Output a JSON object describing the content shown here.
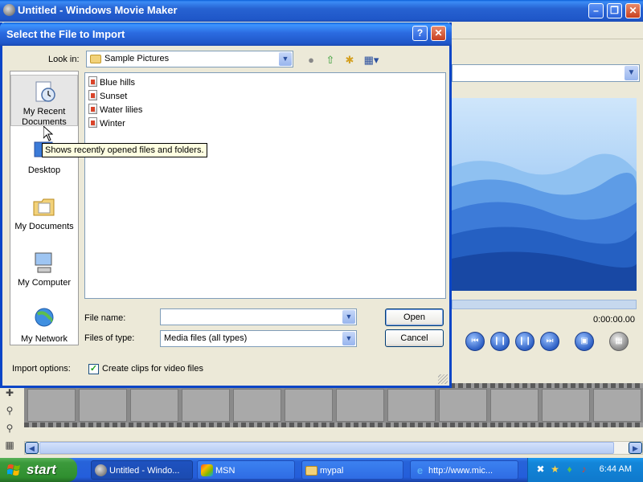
{
  "app": {
    "title": "Untitled - Windows Movie Maker",
    "time_readout": "0:00:00.00"
  },
  "dialog": {
    "title": "Select the File to Import",
    "look_in_label": "Look in:",
    "look_in_value": "Sample Pictures",
    "places": [
      {
        "label": "My Recent Documents",
        "icon": "recent-documents-icon"
      },
      {
        "label": "Desktop",
        "icon": "desktop-icon"
      },
      {
        "label": "My Documents",
        "icon": "my-documents-icon"
      },
      {
        "label": "My Computer",
        "icon": "my-computer-icon"
      },
      {
        "label": "My Network",
        "icon": "my-network-icon"
      }
    ],
    "files": [
      "Blue hills",
      "Sunset",
      "Water lilies",
      "Winter"
    ],
    "file_name_label": "File name:",
    "file_name_value": "",
    "files_of_type_label": "Files of type:",
    "files_of_type_value": "Media files (all types)",
    "open_label": "Open",
    "cancel_label": "Cancel",
    "import_options_label": "Import options:",
    "create_clips_label": "Create clips for video files",
    "create_clips_checked": true,
    "tooltip": "Shows recently opened files and folders."
  },
  "taskbar": {
    "start_label": "start",
    "tasks": [
      {
        "label": "Untitled - Windo...",
        "icon": "movie-maker-icon",
        "active": true
      },
      {
        "label": "MSN",
        "icon": "msn-icon",
        "active": false
      },
      {
        "label": "mypal",
        "icon": "folder-icon",
        "active": false
      },
      {
        "label": "http://www.mic...",
        "icon": "internet-explorer-icon",
        "active": false
      }
    ],
    "clock": "6:44 AM"
  },
  "colors": {
    "title_blue": "#1F56C8",
    "taskbar_blue": "#245EDB",
    "start_green": "#3C9A3C",
    "tray_blue": "#1386D9"
  }
}
